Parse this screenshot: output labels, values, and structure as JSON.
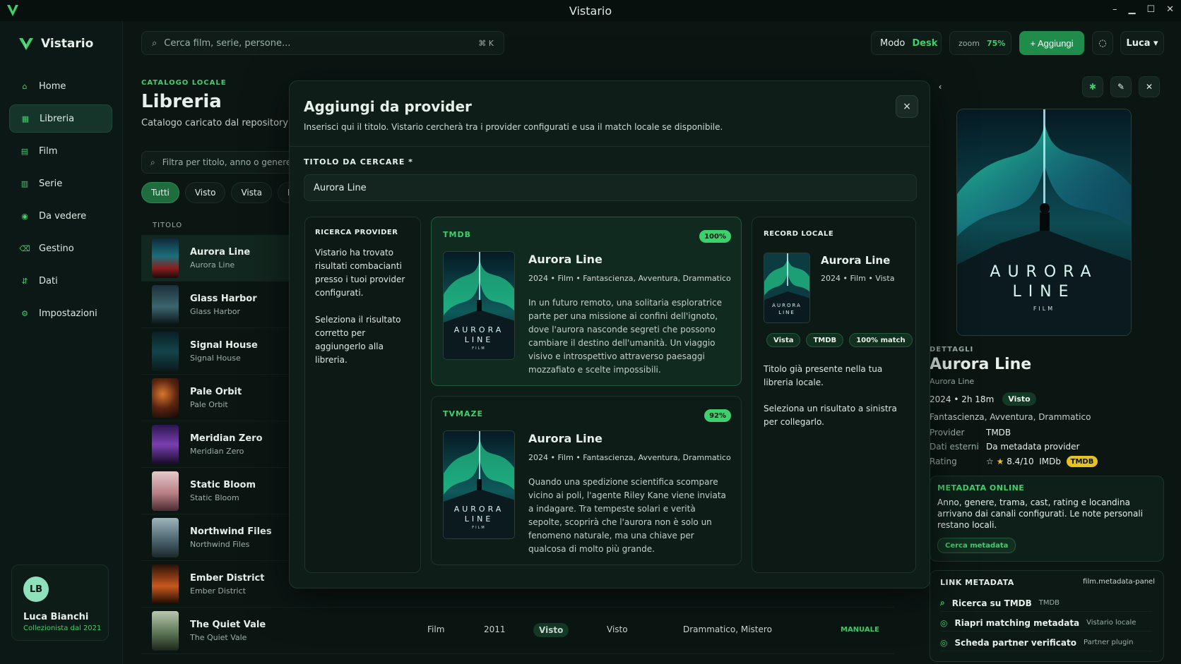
{
  "window": {
    "title": "Vistario"
  },
  "brand": {
    "name": "Vistario"
  },
  "nav": {
    "items": [
      {
        "label": "Home"
      },
      {
        "label": "Libreria"
      },
      {
        "label": "Film"
      },
      {
        "label": "Serie"
      },
      {
        "label": "Da vedere"
      },
      {
        "label": "Gestino"
      },
      {
        "label": "Dati"
      },
      {
        "label": "Impostazioni"
      }
    ]
  },
  "user": {
    "initials": "LB",
    "name": "Luca Bianchi",
    "subtitle": "Collezionista dal 2021"
  },
  "topbar": {
    "search_placeholder": "Cerca film, serie, persone...",
    "search_shortcut": "⌘ K",
    "mode_label": "Modo",
    "mode_value": "Desk",
    "zoom_label": "zoom",
    "zoom_value": "75%",
    "add_label": "+ Aggiungi",
    "user_menu": "Luca ▾"
  },
  "library": {
    "eyebrow": "CATALOGO LOCALE",
    "title": "Libreria",
    "subtitle": "Catalogo caricato dal repository loa",
    "filter_placeholder": "Filtra per titolo, anno o genere",
    "chips": [
      "Tutti",
      "Visto",
      "Vista",
      "Da v"
    ],
    "column_title": "TITOLO",
    "rows": [
      {
        "title": "Aurora Line",
        "sub": "Aurora Line"
      },
      {
        "title": "Glass Harbor",
        "sub": "Glass Harbor"
      },
      {
        "title": "Signal House",
        "sub": "Signal House"
      },
      {
        "title": "Pale Orbit",
        "sub": "Pale Orbit"
      },
      {
        "title": "Meridian Zero",
        "sub": "Meridian Zero"
      },
      {
        "title": "Static Bloom",
        "sub": "Static Bloom"
      },
      {
        "title": "Northwind Files",
        "sub": "Northwind Files"
      },
      {
        "title": "Ember District",
        "sub": "Ember District"
      },
      {
        "title": "The Quiet Vale",
        "sub": "The Quiet Vale",
        "type": "Film",
        "year": "2011",
        "badge": "Visto",
        "status": "Visto",
        "genres": "Drammatico, Mistero",
        "source": "MANUALE"
      }
    ]
  },
  "modal": {
    "title": "Aggiungi da provider",
    "subtitle": "Inserisci qui il titolo. Vistario cercherà tra i provider configurati e usa il match locale se disponibile.",
    "close": "×",
    "field_label": "TITOLO DA CERCARE *",
    "field_value": "Aurora Line",
    "provider_box": {
      "header": "RICERCA PROVIDER",
      "p1": "Vistario ha trovato risultati combacianti presso i tuoi provider configurati.",
      "p2": "Seleziona il risultato corretto per aggiungerlo alla libreria."
    },
    "results": [
      {
        "provider": "TMDB",
        "match": "100%",
        "title": "Aurora Line",
        "meta": "2024 • Film • Fantascienza, Avventura, Drammatico",
        "desc": "In un futuro remoto, una solitaria esploratrice parte per una missione ai confini dell'ignoto, dove l'aurora nasconde segreti che possono cambiare il destino dell'umanità. Un viaggio visivo e introspettivo attraverso paesaggi mozzafiato e scelte impossibili."
      },
      {
        "provider": "TVMAZE",
        "match": "92%",
        "title": "Aurora Line",
        "meta": "2024 • Film • Fantascienza, Avventura, Drammatico",
        "desc": "Quando una spedizione scientifica scompare vicino ai poli, l'agente Riley Kane viene inviata a indagare. Tra tempeste solari e verità sepolte, scoprirà che l'aurora non è solo un fenomeno naturale, ma una chiave per qualcosa di molto più grande."
      }
    ],
    "local": {
      "header": "RECORD LOCALE",
      "title": "Aurora Line",
      "meta": "2024 • Film • Vista",
      "tags": [
        "Vista",
        "TMDB",
        "100% match"
      ],
      "p1": "Titolo già presente nella tua libreria locale.",
      "p2": "Seleziona un risultato a sinistra per collegarlo."
    },
    "poster_text": {
      "l1": "AURORA",
      "l2": "LINE",
      "l3": "FILM"
    }
  },
  "details": {
    "eyebrow": "DETTAGLI",
    "title": "Aurora Line",
    "sub": "Aurora Line",
    "year_runtime": "2024 • 2h 18m",
    "status": "Visto",
    "genres": "Fantascienza, Avventura, Drammatico",
    "provider_k": "Provider",
    "provider_v": "TMDB",
    "external_k": "Dati esterni",
    "external_v": "Da metadata provider",
    "rating_k": "Rating",
    "rating_v": "8.4/10",
    "rating_src": "IMDb",
    "rating_badge": "TMDB",
    "poster": {
      "l1": "AURORA",
      "l2": "LINE",
      "l3": "FILM"
    },
    "meta_online": {
      "header": "METADATA ONLINE",
      "text": "Anno, genere, trama, cast, rating e locandina arrivano dai canali configurati. Le note personali restano locali.",
      "button": "Cerca metadata"
    },
    "links": {
      "header": "LINK METADATA",
      "panel": "film.metadata-panel",
      "items": [
        {
          "label": "Ricerca su TMDB",
          "sub": "TMDB"
        },
        {
          "label": "Riapri matching metadata",
          "sub": "Vistario locale"
        },
        {
          "label": "Scheda partner verificato",
          "sub": "Partner plugin"
        }
      ]
    }
  },
  "colors": {
    "accent": "#3fcf6c",
    "bg": "#0b1613",
    "gold": "#e8c31f"
  }
}
